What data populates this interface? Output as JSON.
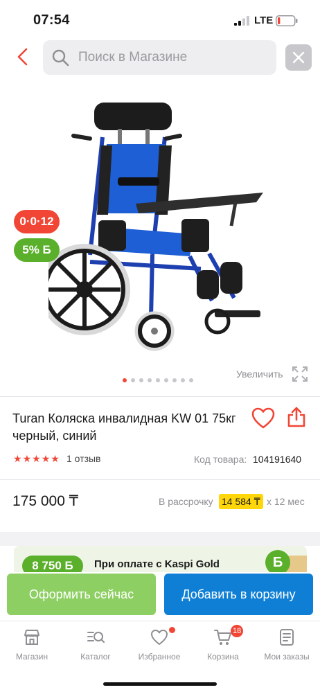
{
  "status_bar": {
    "time": "07:54",
    "network": "LTE",
    "battery_level": 0.15,
    "battery_color": "#f14635"
  },
  "search": {
    "placeholder": "Поиск в Магазине",
    "icons": [
      "chevron-left-icon",
      "search-icon",
      "close-icon"
    ],
    "accent": "#f14635"
  },
  "gallery": {
    "image": "wheelchair-photo",
    "badges": {
      "installment": "0·0·12",
      "bonus": "5% Б"
    },
    "dots_count": 9,
    "active_dot": 0,
    "zoom_label": "Увеличить"
  },
  "product": {
    "title": "Turan Коляска инвалидная KW 01 75кг черный, синий",
    "rating": 5,
    "reviews": "1 отзыв",
    "code_label": "Код товара:",
    "code_value": "104191640",
    "price": "175 000 ₸",
    "installment_label": "В рассрочку",
    "installment_amount": "14 584 ₸",
    "installment_term": "х 12 мес"
  },
  "promo": {
    "amount": "8 750 Б",
    "text": "При оплате с Kaspi Gold",
    "bonus_symbol": "Б"
  },
  "actions": {
    "buy_now": "Оформить сейчас",
    "add_to_cart": "Добавить в корзину",
    "buy_now_color": "#8dcf62",
    "add_to_cart_color": "#0f7fd6"
  },
  "tab_bar": {
    "tabs": [
      {
        "label": "Магазин",
        "icon": "store-icon"
      },
      {
        "label": "Каталог",
        "icon": "catalog-search-icon"
      },
      {
        "label": "Избранное",
        "icon": "heart-icon"
      },
      {
        "label": "Корзина",
        "icon": "cart-icon"
      },
      {
        "label": "Мои заказы",
        "icon": "orders-icon"
      }
    ],
    "cart_count": "18"
  }
}
